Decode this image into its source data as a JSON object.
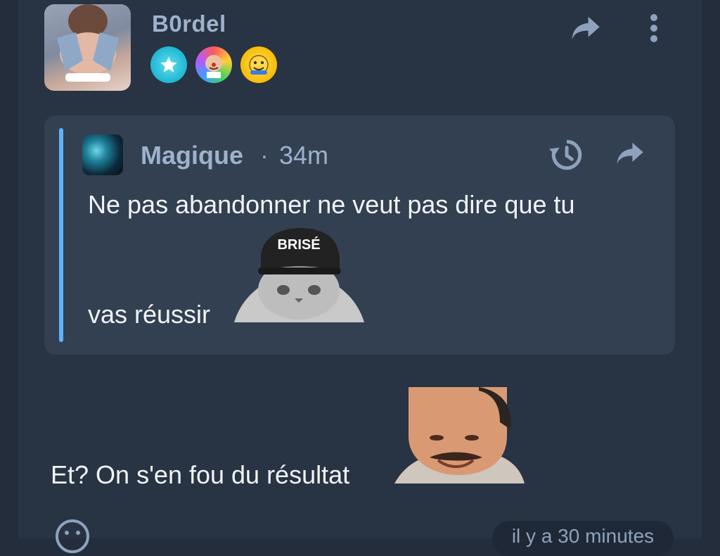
{
  "post": {
    "author": "B0rdel",
    "badges": [
      {
        "icon": "star-badge-icon",
        "color": "#1fb6d2"
      },
      {
        "icon": "face-badge-icon",
        "color": "#ff5a5a"
      },
      {
        "icon": "emoji-badge-icon",
        "color": "#f6b800"
      }
    ],
    "text": "Et? On s'en fou du résultat",
    "time_label": "il y a 30 minutes"
  },
  "quote": {
    "author": "Magique",
    "separator": "·",
    "time": "34m",
    "line1": "Ne pas abandonner ne veut pas dire que tu",
    "line2": "vas réussir",
    "sticker_text": "BRISÉ",
    "accent_color": "#5fb2f5"
  },
  "icons": {
    "share": "share-icon",
    "more": "more-vertical-icon",
    "history": "history-icon",
    "reaction": "emoji-reaction-icon"
  }
}
